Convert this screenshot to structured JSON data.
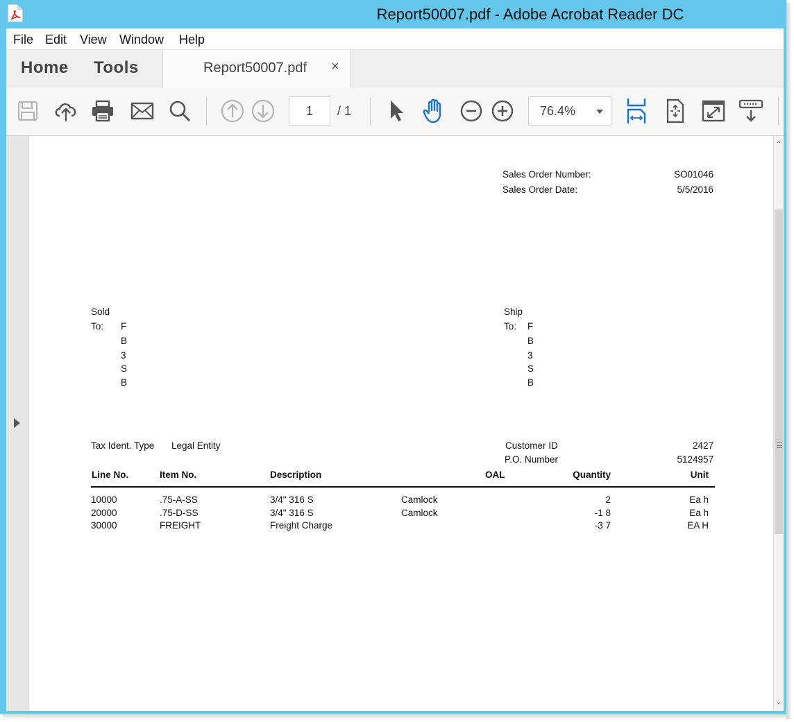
{
  "window": {
    "title": "Report50007.pdf - Adobe Acrobat Reader DC"
  },
  "menu": [
    "File",
    "Edit",
    "View",
    "Window",
    "Help"
  ],
  "tabs": {
    "home": "Home",
    "tools": "Tools",
    "document": "Report50007.pdf",
    "close": "×"
  },
  "toolbar": {
    "icons": [
      "save-icon",
      "cloud-upload-icon",
      "print-icon",
      "email-icon",
      "search-icon",
      "page-up-icon",
      "page-down-icon",
      "select-arrow-icon",
      "hand-tool-icon",
      "zoom-out-icon",
      "zoom-in-icon",
      "fit-width-icon",
      "fit-page-icon",
      "full-screen-icon",
      "read-mode-icon"
    ],
    "page_current": "1",
    "page_total": "/  1",
    "zoom": "76.4%",
    "accent_color": "#1a73c9"
  },
  "report": {
    "header": {
      "order_number_label": "Sales Order Number:",
      "order_number": "SO01046",
      "order_date_label": "Sales Order Date:",
      "order_date": "5/5/2016"
    },
    "sold_to": {
      "label1": "Sold",
      "label2": "To:",
      "lines": [
        "F",
        "B",
        "3",
        "S",
        "B"
      ]
    },
    "ship_to": {
      "label1": "Ship",
      "label2": "To:",
      "lines": [
        "F",
        "B",
        "3",
        "S",
        "B"
      ]
    },
    "info": {
      "tax_ident_label": "Tax Ident. Type",
      "tax_ident_value": "Legal Entity",
      "customer_id_label": "Customer ID",
      "customer_id": "2427",
      "po_label": "P.O. Number",
      "po_number": "5124957"
    },
    "columns": [
      "Line No.",
      "Item No.",
      "Description",
      "OAL",
      "Quantity",
      "Unit"
    ],
    "rows": [
      {
        "line": "10000",
        "item": ".75-A-SS",
        "desc": "3/4\" 316 S",
        "desc2": "Camlock",
        "qty": "2",
        "unit": "Ea h"
      },
      {
        "line": "20000",
        "item": ".75-D-SS",
        "desc": "3/4\" 316 S",
        "desc2": "Camlock",
        "qty": "-1 8",
        "unit": "Ea h"
      },
      {
        "line": "30000",
        "item": "FREIGHT",
        "desc": "Freight Charge",
        "desc2": "",
        "qty": "-3 7",
        "unit": "EA H"
      }
    ]
  }
}
